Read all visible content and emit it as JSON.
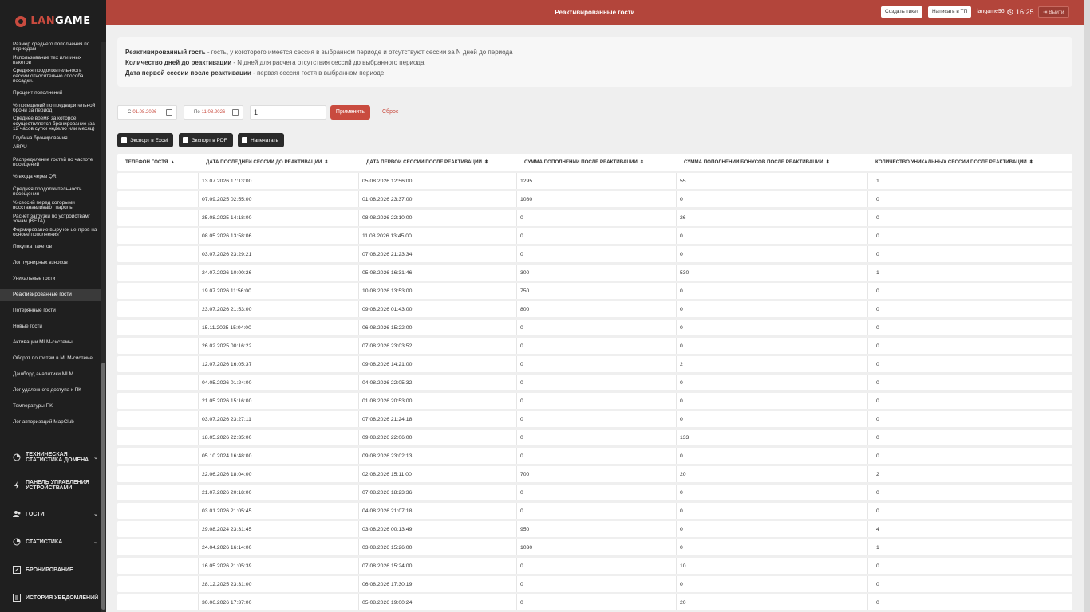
{
  "brand": {
    "logo_text_1": "LAN",
    "logo_text_2": "GAME"
  },
  "header": {
    "title": "Реактивированные гости",
    "create_ticket": "Создать тикет",
    "write_support": "Написать в ТП",
    "username": "langame96",
    "time": "16:25",
    "logout": "Выйти"
  },
  "sidebar": {
    "items": [
      "Размер среднего пополнения по периодам",
      "Использование тех или иных пакетов",
      "Средняя продолжительность сессии относительно способа посадки.",
      "Процент пополнений",
      "% посещений по предварительной брони за период",
      "Среднее время за которое осуществляется бронирование (за 12 часов сутки неделю или месяц)",
      "Глубина бронирования",
      "ARPU",
      "Распределение гостей по частоте посещений",
      "% входа через QR",
      "Средняя продолжительность посещения",
      "% сессий перед которыми восстанавливают пароль",
      "Расчет загрузки по устройствам/зонам (BETA)",
      "Формирование выручек центров на основе пополнения",
      "Покупка пакетов",
      "Лог турнирных взносов",
      "Уникальные гости",
      "Реактивированные гости",
      "Потерянные гости",
      "Новые гости",
      "Активации MLM-системы",
      "Оборот по гостям в MLM-системе",
      "Дашборд аналитики MLM",
      "Лог удаленного доступа к ПК",
      "Температуры ПК",
      "Лог авторизаций MapClub"
    ],
    "sections": [
      {
        "label": "ТЕХНИЧЕСКАЯ СТАТИСТИКА ДОМЕНА",
        "icon": "pie-chart-icon"
      },
      {
        "label": "ПАНЕЛЬ УПРАВЛЕНИЯ УСТРОЙСТВАМИ",
        "icon": "bolt-icon"
      },
      {
        "label": "ГОСТИ",
        "icon": "users-icon"
      },
      {
        "label": "СТАТИСТИКА",
        "icon": "pie-chart-icon"
      },
      {
        "label": "БРОНИРОВАНИЕ",
        "icon": "edit-icon"
      },
      {
        "label": "ИСТОРИЯ УВЕДОМЛЕНИЙ",
        "icon": "list-icon"
      }
    ]
  },
  "info": {
    "line1_term": "Реактивированный гость",
    "line1_desc": " - гость, у коготорого имеется сессия в выбранном периоде и отсутствуют сессии за N дней до периода",
    "line2_term": "Количество дней до реактивации",
    "line2_desc": " - N дней для расчета отсутствия сессий до выбранного периода",
    "line3_term": "Дата первой сессии после реактивации",
    "line3_desc": " - первая сессия гостя в выбранном периоде"
  },
  "filters": {
    "from_label": "С",
    "from_value": "01.08.2026",
    "to_label": "По",
    "to_value": "11.08.2026",
    "days_value": "1",
    "apply": "Применить",
    "reset": "Сброс"
  },
  "exports": {
    "excel": "Экспорт в Excel",
    "pdf": "Экспорт в PDF",
    "print": "Напечатать"
  },
  "table": {
    "columns": [
      "ТЕЛЕФОН ГОСТЯ",
      "ДАТА ПОСЛЕДНЕЙ СЕССИИ ДО РЕАКТИВАЦИИ",
      "ДАТА ПЕРВОЙ СЕССИИ ПОСЛЕ РЕАКТИВАЦИИ",
      "СУММА ПОПОЛНЕНИЙ ПОСЛЕ РЕАКТИВАЦИИ",
      "СУММА ПОПОЛНЕНИЙ БОНУСОВ ПОСЛЕ РЕАКТИВАЦИИ",
      "КОЛИЧЕСТВО УНИКАЛЬНЫХ СЕССИЙ ПОСЛЕ РЕАКТИВАЦИИ"
    ],
    "rows": [
      [
        "",
        "13.07.2026 17:13:00",
        "05.08.2026 12:56:00",
        "1295",
        "55",
        "1"
      ],
      [
        "",
        "07.09.2025 02:55:00",
        "01.08.2026 23:37:00",
        "1080",
        "0",
        "0"
      ],
      [
        "",
        "25.08.2025 14:18:00",
        "08.08.2026 22:10:00",
        "0",
        "26",
        "0"
      ],
      [
        "",
        "08.05.2026 13:58:06",
        "11.08.2026 13:45:00",
        "0",
        "0",
        "0"
      ],
      [
        "",
        "03.07.2026 23:29:21",
        "07.08.2026 21:23:34",
        "0",
        "0",
        "0"
      ],
      [
        "",
        "24.07.2026 10:00:26",
        "05.08.2026 16:31:46",
        "300",
        "530",
        "1"
      ],
      [
        "",
        "19.07.2026 11:56:00",
        "10.08.2026 13:53:00",
        "750",
        "0",
        "0"
      ],
      [
        "",
        "23.07.2026 21:53:00",
        "09.08.2026 01:43:00",
        "800",
        "0",
        "0"
      ],
      [
        "",
        "15.11.2025 15:04:00",
        "06.08.2026 15:22:00",
        "0",
        "0",
        "0"
      ],
      [
        "",
        "26.02.2025 00:16:22",
        "07.08.2026 23:03:52",
        "0",
        "0",
        "0"
      ],
      [
        "",
        "12.07.2026 16:05:37",
        "09.08.2026 14:21:00",
        "0",
        "2",
        "0"
      ],
      [
        "",
        "04.05.2026 01:24:00",
        "04.08.2026 22:05:32",
        "0",
        "0",
        "0"
      ],
      [
        "",
        "21.05.2026 15:16:00",
        "01.08.2026 20:53:00",
        "0",
        "0",
        "0"
      ],
      [
        "",
        "03.07.2026 23:27:11",
        "07.08.2026 21:24:18",
        "0",
        "0",
        "0"
      ],
      [
        "",
        "18.05.2026 22:35:00",
        "09.08.2026 22:06:00",
        "0",
        "133",
        "0"
      ],
      [
        "",
        "05.10.2024 16:48:00",
        "09.08.2026 23:02:13",
        "0",
        "0",
        "0"
      ],
      [
        "",
        "22.06.2026 18:04:00",
        "02.08.2026 15:11:00",
        "700",
        "20",
        "2"
      ],
      [
        "",
        "21.07.2026 20:18:00",
        "07.08.2026 18:23:36",
        "0",
        "0",
        "0"
      ],
      [
        "",
        "03.01.2026 21:05:45",
        "04.08.2026 21:07:18",
        "0",
        "0",
        "0"
      ],
      [
        "",
        "29.08.2024 23:31:45",
        "03.08.2026 00:13:49",
        "950",
        "0",
        "4"
      ],
      [
        "",
        "24.04.2026 16:14:00",
        "03.08.2026 15:26:00",
        "1030",
        "0",
        "1"
      ],
      [
        "",
        "16.05.2026 21:05:39",
        "07.08.2026 15:24:00",
        "0",
        "10",
        "0"
      ],
      [
        "",
        "28.12.2025 23:31:00",
        "06.08.2026 17:30:19",
        "0",
        "0",
        "0"
      ],
      [
        "",
        "30.06.2026 17:37:00",
        "05.08.2026 19:00:24",
        "0",
        "20",
        "0"
      ]
    ]
  }
}
